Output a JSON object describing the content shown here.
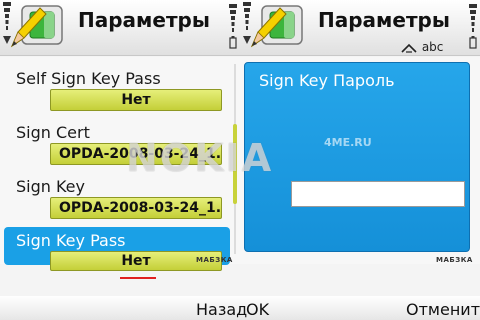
{
  "left_screen": {
    "title": "Параметры",
    "settings": [
      {
        "label": "Self Sign Key Pass",
        "value": "Нет"
      },
      {
        "label": "Sign Cert",
        "value": "OPDA-2008-03-24_1.0..."
      },
      {
        "label": "Sign Key",
        "value": "OPDA-2008-03-24_1...."
      },
      {
        "label": "Sign Key Pass",
        "value": "Нет",
        "selected": true
      }
    ],
    "softkey_left": "Назад",
    "brand_mark": "МАБЗКА"
  },
  "right_screen": {
    "title": "Параметры",
    "input_mode_indicator": "abc",
    "dialog": {
      "title": "Sign Key Пароль",
      "input_value": ""
    },
    "softkey_left": "OK",
    "softkey_right": "Отменить",
    "brand_mark": "МАБЗКА"
  },
  "watermark": {
    "main": "NOKIA",
    "sup": "4ME.RU"
  },
  "colors": {
    "selection": "#1aa0e6",
    "value_field": "#d6df56",
    "dialog_bg": "#1d9ae0",
    "titlebar": "#f0f0f0"
  },
  "icons": [
    "signal-icon",
    "battery-icon",
    "settings-app-icon",
    "pencil-icon",
    "keypad-arrow-icon"
  ]
}
